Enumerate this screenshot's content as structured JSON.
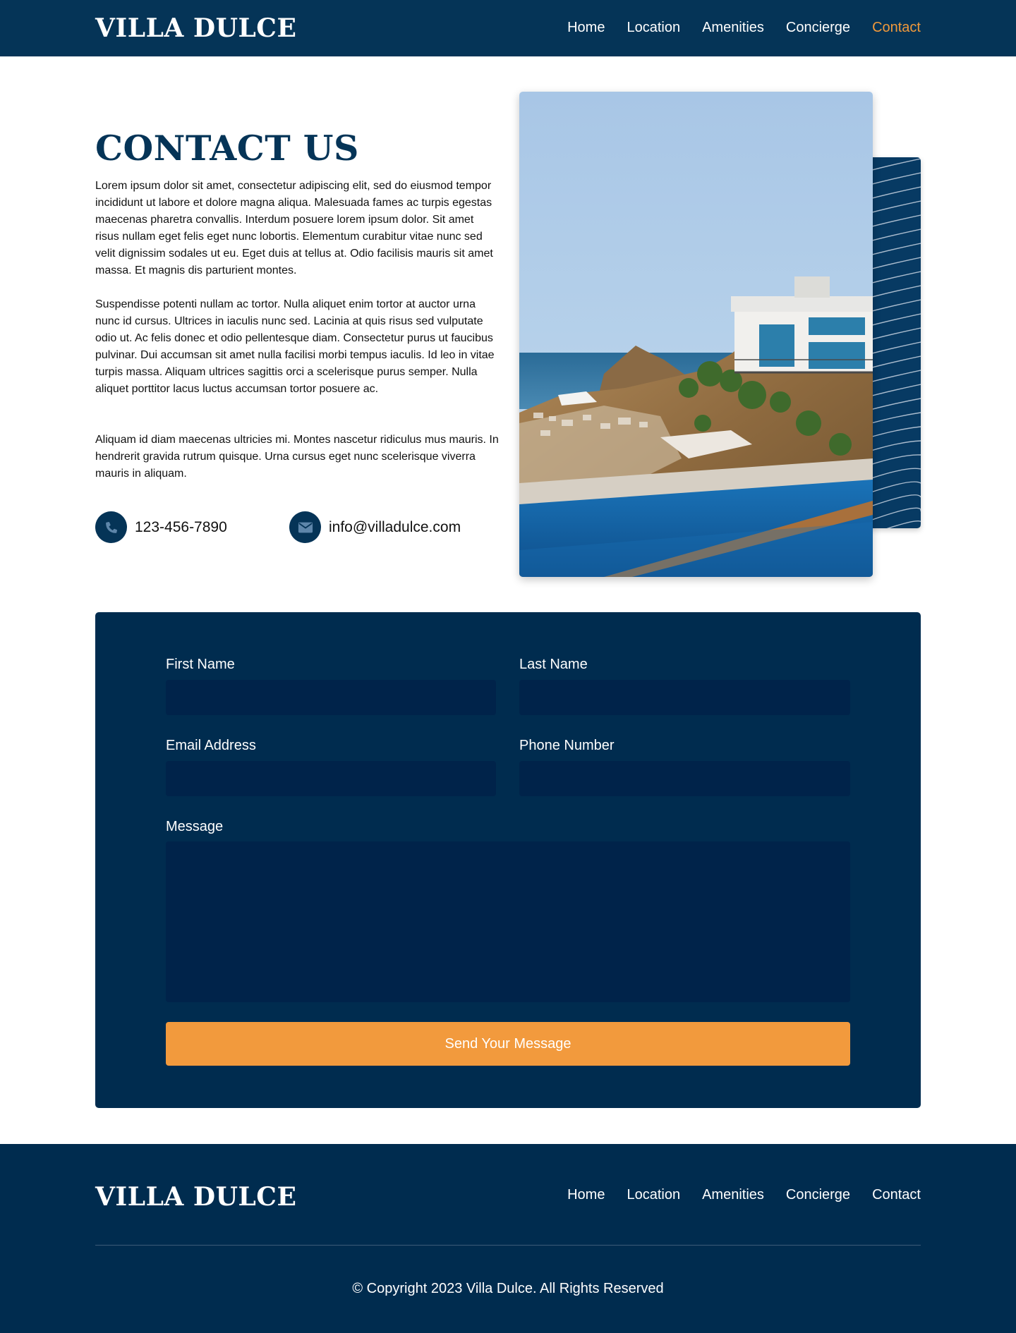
{
  "header": {
    "logo": "VILLA DULCE",
    "nav": [
      "Home",
      "Location",
      "Amenities",
      "Concierge",
      "Contact"
    ],
    "active_nav": "Contact"
  },
  "intro": {
    "title": "CONTACT US",
    "paragraphs": [
      "Lorem ipsum dolor sit amet, consectetur adipiscing elit, sed do eiusmod tempor incididunt ut labore et dolore magna aliqua. Malesuada fames ac turpis egestas maecenas pharetra convallis. Interdum posuere lorem ipsum dolor. Sit amet risus nullam eget felis eget nunc lobortis. Elementum curabitur vitae nunc sed velit dignissim sodales ut eu. Eget duis at tellus at. Odio facilisis mauris sit amet massa. Et magnis dis parturient montes.",
      "Suspendisse potenti nullam ac tortor. Nulla aliquet enim tortor at auctor urna nunc id cursus. Ultrices in iaculis nunc sed. Lacinia at quis risus sed vulputate odio ut. Ac felis donec et odio pellentesque diam. Consectetur purus ut faucibus pulvinar. Dui accumsan sit amet nulla facilisi morbi tempus iaculis. Id leo in vitae turpis massa. Aliquam ultrices sagittis orci a scelerisque purus semper. Nulla aliquet porttitor lacus luctus accumsan tortor posuere ac.",
      "Aliquam id diam maecenas ultricies mi. Montes nascetur ridiculus mus mauris. In hendrerit gravida rutrum quisque. Urna cursus eget nunc scelerisque viverra mauris in aliquam."
    ],
    "phone": {
      "icon": "phone-icon",
      "text": "123-456-7890"
    },
    "email": {
      "icon": "envelope-icon",
      "text": "info@villadulce.com"
    }
  },
  "form": {
    "first_name_label": "First Name",
    "last_name_label": "Last Name",
    "email_label": "Email Address",
    "phone_label": "Phone Number",
    "message_label": "Message",
    "first_name_value": "",
    "last_name_value": "",
    "email_value": "",
    "phone_value": "",
    "message_value": "",
    "submit_label": "Send Your Message"
  },
  "footer": {
    "logo": "VILLA DULCE",
    "nav": [
      "Home",
      "Location",
      "Amenities",
      "Concierge",
      "Contact"
    ],
    "copyright": "© Copyright 2023 Villa Dulce. All Rights Reserved"
  },
  "colors": {
    "navy": "#053457",
    "panel": "#002c4f",
    "input": "#00234a",
    "accent": "#f29a3d",
    "active_nav": "#f0993b"
  }
}
